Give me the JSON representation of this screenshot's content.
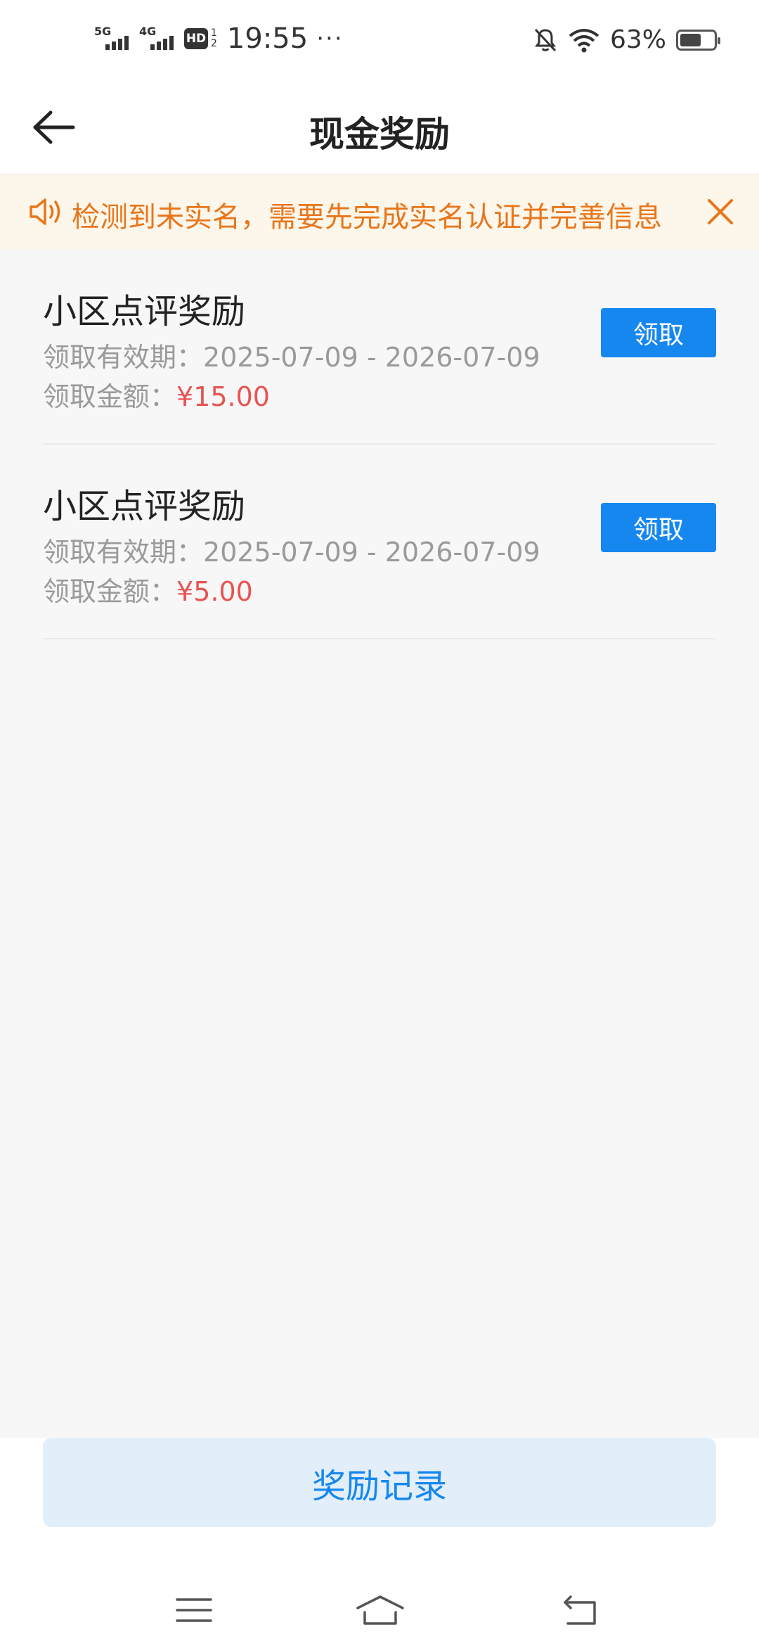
{
  "status_bar": {
    "network1": "5G",
    "network2": "4G",
    "hd_label": "HD",
    "hd_sub1": "1",
    "hd_sub2": "2",
    "time": "19:55",
    "more": "···",
    "battery_percent": "63%",
    "battery_level": 0.63,
    "icons": [
      "bell-off-icon",
      "wifi-icon",
      "battery-icon"
    ]
  },
  "header": {
    "title": "现金奖励",
    "back_icon": "arrow-left-icon"
  },
  "notice": {
    "text": "检测到未实名，需要先完成实名认证并完善信息",
    "icon": "speaker-icon",
    "close_icon": "close-icon",
    "accent": "#e8761b"
  },
  "rewards": [
    {
      "title": "小区点评奖励",
      "validity_label": "领取有效期：",
      "validity": "2025-07-09 - 2026-07-09",
      "amount_label": "领取金额：",
      "amount": "¥15.00",
      "button": "领取"
    },
    {
      "title": "小区点评奖励",
      "validity_label": "领取有效期：",
      "validity": "2025-07-09 - 2026-07-09",
      "amount_label": "领取金额：",
      "amount": "¥5.00",
      "button": "领取"
    }
  ],
  "footer": {
    "records_button": "奖励记录"
  },
  "nav_bar": {
    "icons": [
      "menu-icon",
      "home-icon",
      "back-nav-icon"
    ]
  },
  "colors": {
    "primary": "#1787f0",
    "amount": "#e85454",
    "notice_bg": "#fdf6ea"
  }
}
